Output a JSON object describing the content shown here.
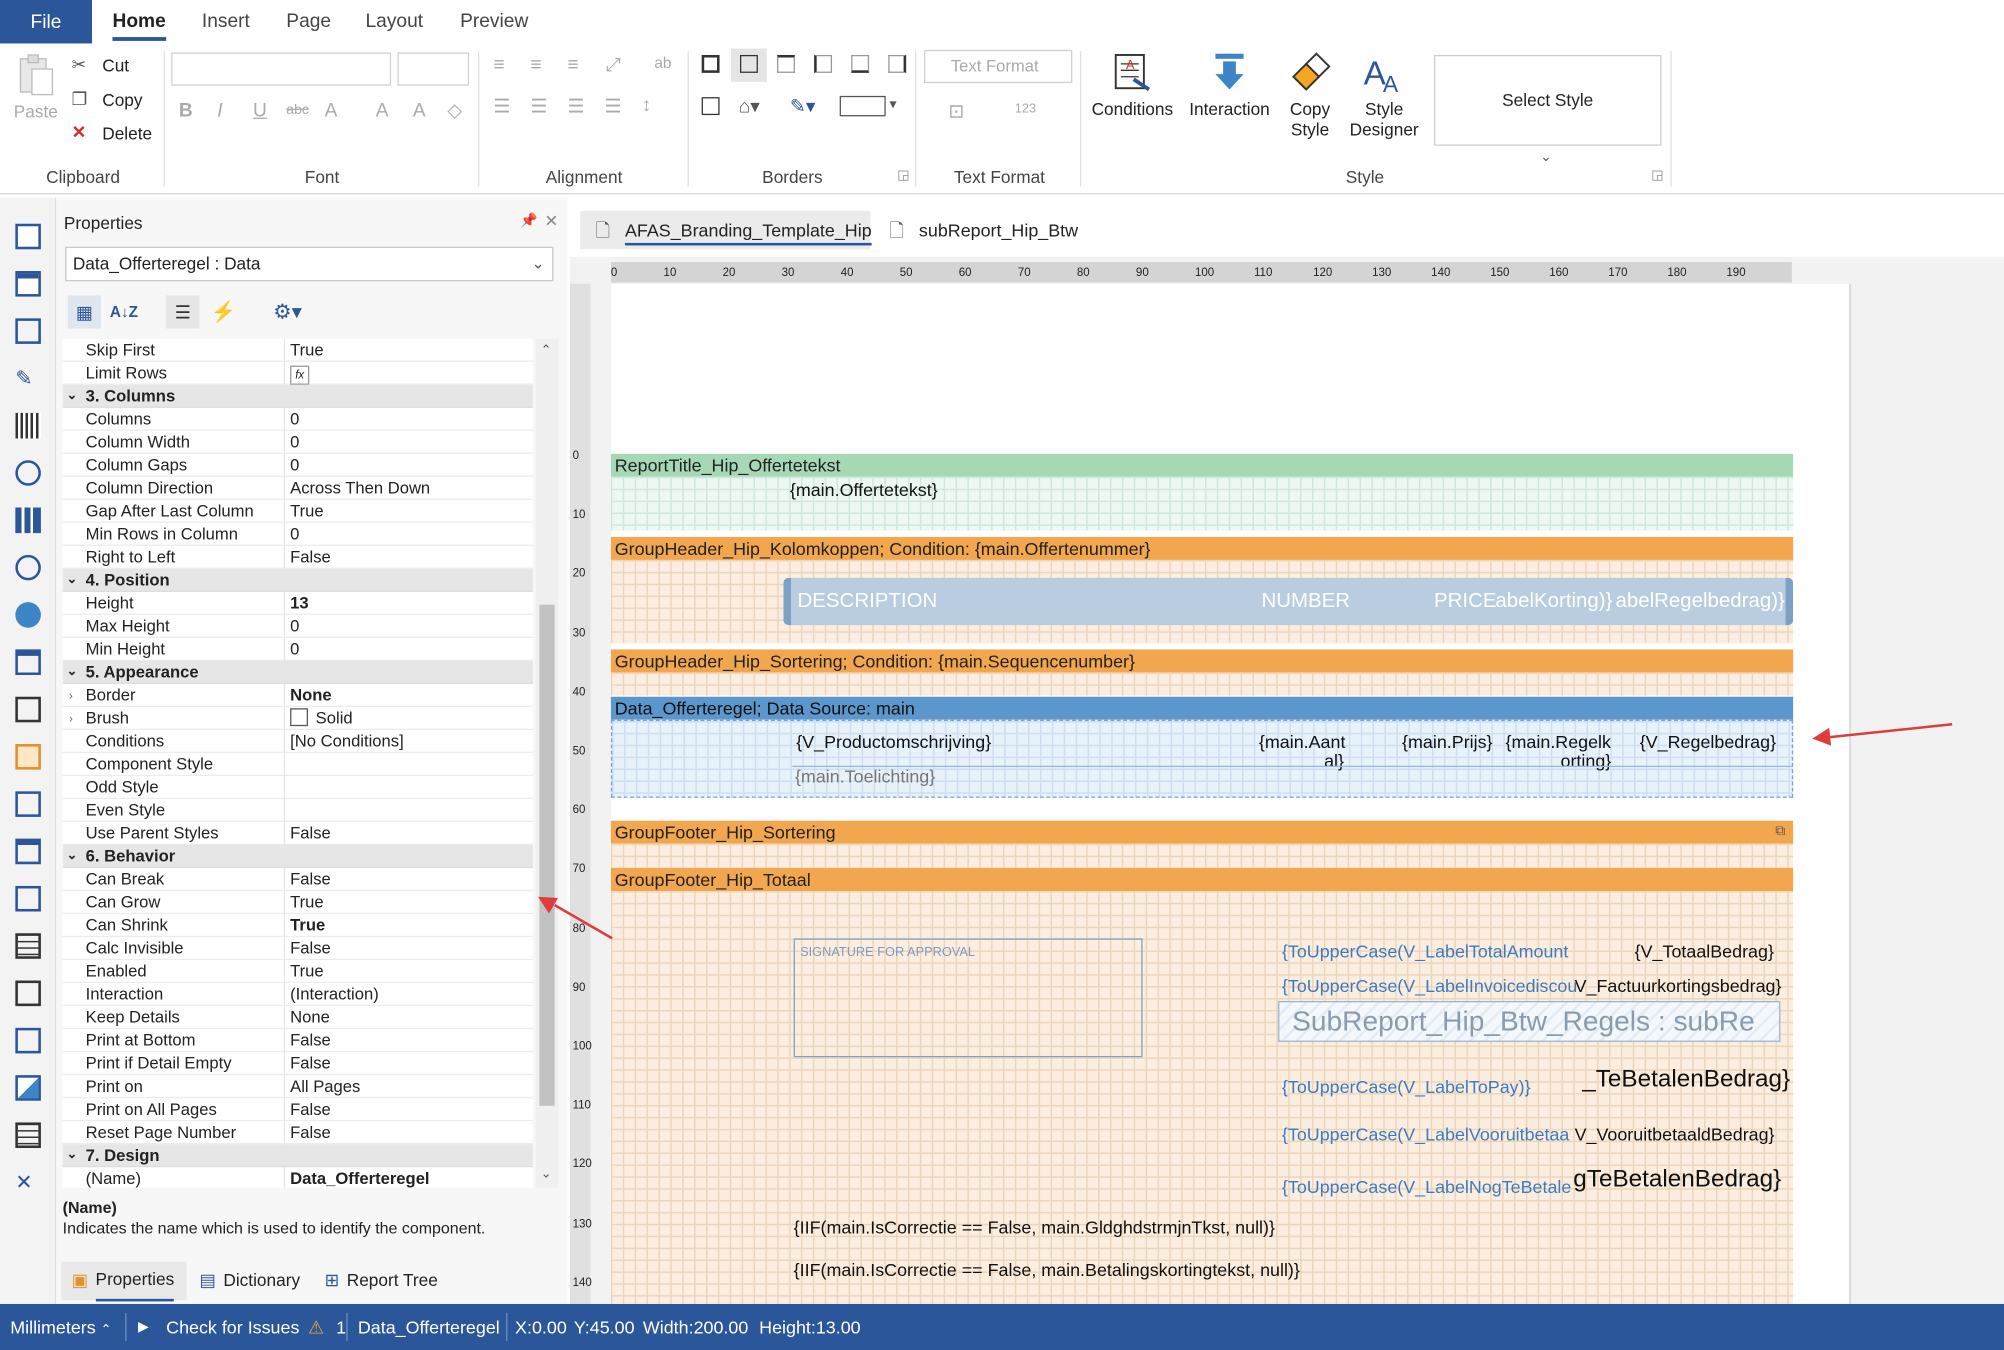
{
  "ribbon": {
    "file": "File",
    "tabs": [
      "Home",
      "Insert",
      "Page",
      "Layout",
      "Preview"
    ],
    "clipboard": {
      "paste": "Paste",
      "cut": "Cut",
      "copy": "Copy",
      "delete": "Delete",
      "label": "Clipboard"
    },
    "font": {
      "label": "Font"
    },
    "alignment": {
      "label": "Alignment"
    },
    "borders": {
      "label": "Borders"
    },
    "text_format": {
      "button": "Text Format",
      "label": "Text Format"
    },
    "style": {
      "conditions": "Conditions",
      "interaction": "Interaction",
      "copy_style_1": "Copy",
      "copy_style_2": "Style",
      "style_designer_1": "Style",
      "style_designer_2": "Designer",
      "select_style": "Select Style",
      "label": "Style"
    }
  },
  "properties": {
    "title": "Properties",
    "selected": "Data_Offerteregel : Data",
    "rows": [
      {
        "n": "Skip First",
        "v": "True"
      },
      {
        "n": "Limit Rows",
        "v": "fx"
      },
      {
        "cat": "3. Columns"
      },
      {
        "n": "Columns",
        "v": "0"
      },
      {
        "n": "Column Width",
        "v": "0"
      },
      {
        "n": "Column Gaps",
        "v": "0"
      },
      {
        "n": "Column Direction",
        "v": "Across Then Down"
      },
      {
        "n": "Gap After Last Column",
        "v": "True"
      },
      {
        "n": "Min Rows in Column",
        "v": "0"
      },
      {
        "n": "Right to Left",
        "v": "False"
      },
      {
        "cat": "4. Position"
      },
      {
        "n": "Height",
        "v": "13",
        "b": true
      },
      {
        "n": "Max Height",
        "v": "0"
      },
      {
        "n": "Min Height",
        "v": "0"
      },
      {
        "cat": "5. Appearance"
      },
      {
        "n": "Border",
        "v": "None",
        "b": true,
        "exp": true
      },
      {
        "n": "Brush",
        "v": "Solid",
        "exp": true,
        "swatch": true
      },
      {
        "n": "Conditions",
        "v": "[No Conditions]"
      },
      {
        "n": "Component Style",
        "v": ""
      },
      {
        "n": "Odd Style",
        "v": ""
      },
      {
        "n": "Even Style",
        "v": ""
      },
      {
        "n": "Use Parent Styles",
        "v": "False"
      },
      {
        "cat": "6. Behavior"
      },
      {
        "n": "Can Break",
        "v": "False"
      },
      {
        "n": "Can Grow",
        "v": "True"
      },
      {
        "n": "Can Shrink",
        "v": "True",
        "b": true
      },
      {
        "n": "Calc Invisible",
        "v": "False"
      },
      {
        "n": "Enabled",
        "v": "True"
      },
      {
        "n": "Interaction",
        "v": "(Interaction)"
      },
      {
        "n": "Keep Details",
        "v": "None"
      },
      {
        "n": "Print at Bottom",
        "v": "False"
      },
      {
        "n": "Print if Detail Empty",
        "v": "False"
      },
      {
        "n": "Print on",
        "v": "All Pages"
      },
      {
        "n": "Print on All Pages",
        "v": "False"
      },
      {
        "n": "Reset Page Number",
        "v": "False"
      },
      {
        "cat": "7. Design"
      },
      {
        "n": "(Name)",
        "v": "Data_Offerteregel",
        "b": true
      }
    ],
    "desc_title": "(Name)",
    "desc_text": "Indicates the name which is used to identify the component.",
    "bottom_tabs": [
      "Properties",
      "Dictionary",
      "Report Tree"
    ]
  },
  "doc_tabs": [
    "AFAS_Branding_Template_Hip",
    "subReport_Hip_Btw"
  ],
  "hruler": [
    "0",
    "10",
    "20",
    "30",
    "40",
    "50",
    "60",
    "70",
    "80",
    "90",
    "100",
    "110",
    "120",
    "130",
    "140",
    "150",
    "160",
    "170",
    "180",
    "190"
  ],
  "vruler": [
    "0",
    "10",
    "20",
    "30",
    "40",
    "50",
    "60",
    "70",
    "80",
    "90",
    "100",
    "110",
    "120",
    "130",
    "140"
  ],
  "report": {
    "title_band": "ReportTitle_Hip_Offertetekst",
    "offertetekst": "{main.Offertetekst}",
    "gh1": "GroupHeader_Hip_Kolomkoppen; Condition: {main.Offertenummer}",
    "col_description": "DESCRIPTION",
    "col_number": "NUMBER",
    "col_price": "PRICE",
    "col_korting": "abelKorting)}",
    "col_regel": "abelRegelbedrag)}",
    "gh2": "GroupHeader_Hip_Sortering; Condition: {main.Sequencenumber}",
    "data": "Data_Offerteregel; Data Source: main",
    "productomschrijving": "{V_Productomschrijving}",
    "aantal_1": "{main.Aant",
    "aantal_2": "al}",
    "prijs": "{main.Prijs}",
    "regelk_1": "{main.Regelk",
    "regelk_2": "orting}",
    "regelbedrag": "{V_Regelbedrag}",
    "toelichting": "{main.Toelichting}",
    "gf1": "GroupFooter_Hip_Sortering",
    "gf2": "GroupFooter_Hip_Totaal",
    "signature": "SIGNATURE FOR APPROVAL",
    "label_total": "{ToUpperCase(V_LabelTotalAmount",
    "totaal": "{V_TotaalBedrag}",
    "label_invoice": "{ToUpperCase(V_LabelInvoicediscou",
    "factuur": "V_Factuurkortingsbedrag}",
    "subreport": "SubReport_Hip_Btw_Regels  : subRe",
    "label_topay": "{ToUpperCase(V_LabelToPay)}",
    "tebetalen": "_TeBetalenBedrag}",
    "label_vooruit": "{ToUpperCase(V_LabelVooruitbetaa",
    "vooruit": "V_VooruitbetaaldBedrag}",
    "label_nog": "{ToUpperCase(V_LabelNogTeBetale",
    "nogtebetalen": "gTeBetalenBedrag}",
    "iif1": "{IIF(main.IsCorrectie == False, main.GldghdstrmjnTkst, null)}",
    "iif2": "{IIF(main.IsCorrectie == False, main.Betalingskortingtekst, null)}"
  },
  "status": {
    "units": "Millimeters",
    "check": "Check for Issues",
    "count": "1",
    "component": "Data_Offerteregel",
    "x": "X:0.00",
    "y": "Y:45.00",
    "w": "Width:200.00",
    "h": "Height:13.00"
  },
  "colors": {
    "accent": "#2b579a",
    "band_orange": "#f2a64e",
    "band_green": "#a6d8b6",
    "band_blue": "#5b97cc",
    "arrow": "#e03c3c"
  }
}
